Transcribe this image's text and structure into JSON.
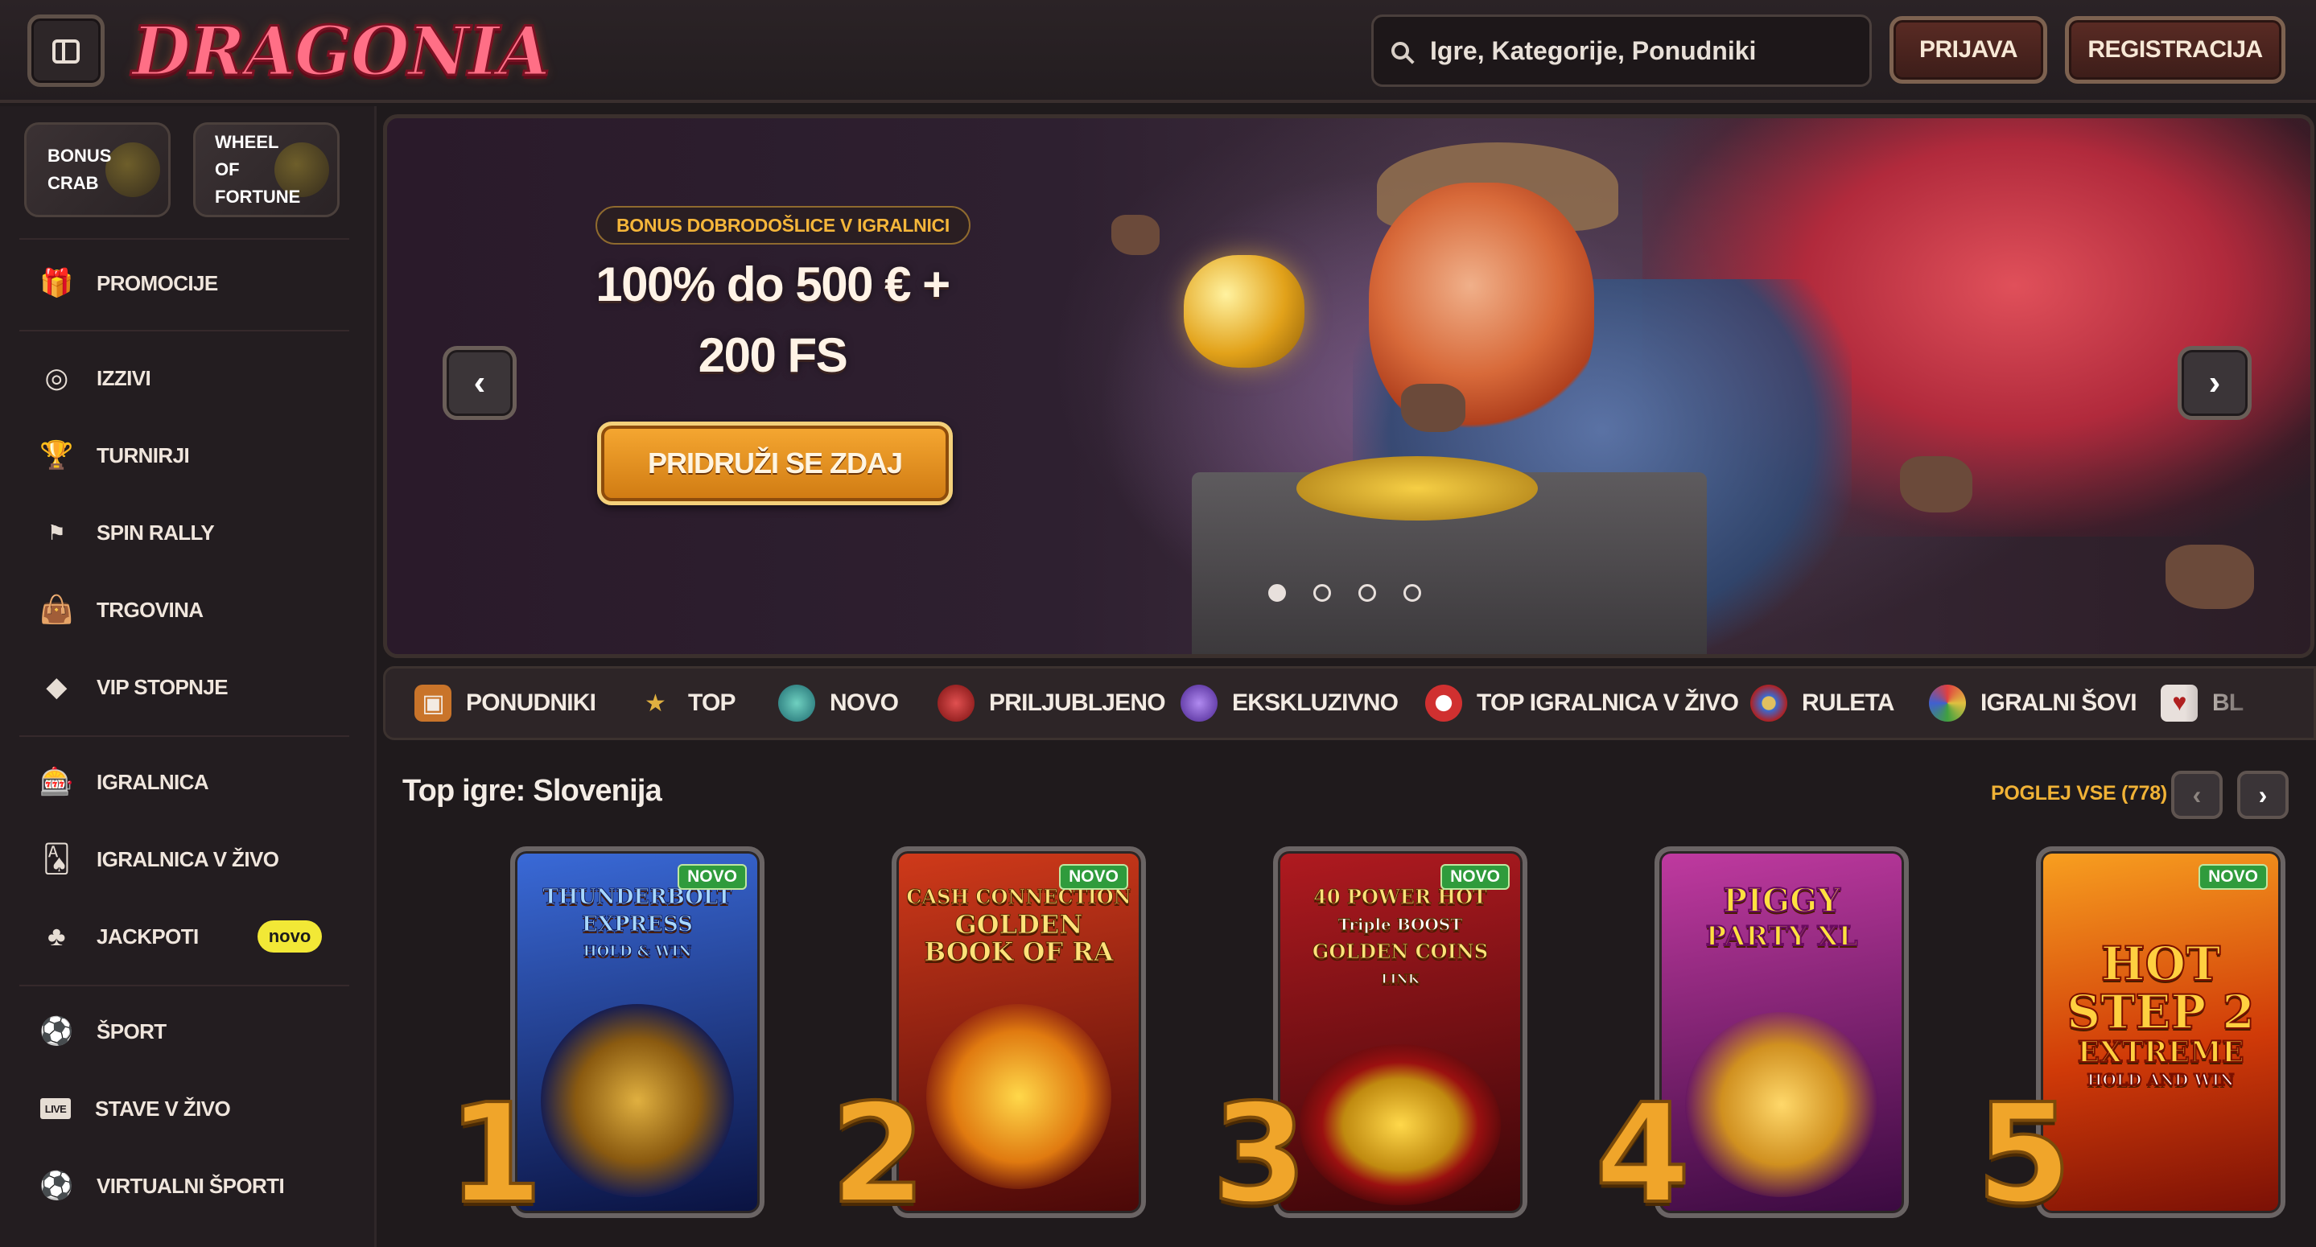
{
  "header": {
    "logo_text": "DRAGONIA",
    "search_placeholder": "Igre, Kategorije, Ponudniki",
    "login_label": "PRIJAVA",
    "register_label": "REGISTRACIJA"
  },
  "sidebar": {
    "features": [
      {
        "lines": [
          "BONUS",
          "CRAB"
        ],
        "icon": "crab-icon"
      },
      {
        "lines": [
          "WHEEL",
          "OF",
          "FORTUNE"
        ],
        "icon": "wheel-icon"
      }
    ],
    "items": [
      {
        "label": "PROMOCIJE",
        "icon": "gift-icon"
      },
      {
        "label": "IZZIVI",
        "icon": "target-icon"
      },
      {
        "label": "TURNIRJI",
        "icon": "trophy-icon"
      },
      {
        "label": "SPIN RALLY",
        "icon": "flag-icon"
      },
      {
        "label": "TRGOVINA",
        "icon": "shopping-bag-icon"
      },
      {
        "label": "VIP STOPNJE",
        "icon": "diamond-icon"
      },
      {
        "label": "IGRALNICA",
        "icon": "slot-machine-icon"
      },
      {
        "label": "IGRALNICA V ŽIVO",
        "icon": "playing-card-icon"
      },
      {
        "label": "JACKPOTI",
        "icon": "clover-icon",
        "badge": "novo"
      },
      {
        "label": "ŠPORT",
        "icon": "ball-icon"
      },
      {
        "label": "STAVE V ŽIVO",
        "icon": "live-icon",
        "icon_text": "LIVE"
      },
      {
        "label": "VIRTUALNI ŠPORTI",
        "icon": "virtual-ball-icon"
      }
    ]
  },
  "hero": {
    "tag": "BONUS DOBRODOŠLICE V IGRALNICI",
    "title_line1": "100% do 500 € +",
    "title_line2": "200 FS",
    "cta": "PRIDRUŽI SE ZDAJ",
    "slides_count": 4,
    "active_slide": 1
  },
  "categories": [
    {
      "label": "PONUDNIKI",
      "icon": "providers-icon",
      "color": "#c9742a"
    },
    {
      "label": "TOP",
      "icon": "star-icon",
      "color": "#e0b040"
    },
    {
      "label": "NOVO",
      "icon": "egg-icon",
      "color": "#3a9a9a"
    },
    {
      "label": "PRILJUBLJENO",
      "icon": "bomb-icon",
      "color": "#c03030"
    },
    {
      "label": "EKSKLUZIVNO",
      "icon": "gem-icon",
      "color": "#7a4ad0"
    },
    {
      "label": "TOP IGRALNICA V ŽIVO",
      "icon": "chip-icon",
      "color": "#d03030"
    },
    {
      "label": "RULETA",
      "icon": "roulette-icon",
      "color": "#3a6ad0"
    },
    {
      "label": "IGRALNI ŠOVI",
      "icon": "wheel-show-icon",
      "color": "#3a9a3a"
    },
    {
      "label": "BL",
      "icon": "cards-icon",
      "color": "#d0d0d0"
    }
  ],
  "top_games": {
    "title": "Top igre: Slovenija",
    "see_all": "POGLEJ VSE (778)",
    "prev": "‹",
    "next": "›",
    "games": [
      {
        "rank": "1",
        "name_lines": [
          "THUNDERBOLT",
          "EXPRESS",
          "HOLD & WIN"
        ],
        "badge": "NOVO",
        "bg1": "#1e3fa8",
        "bg2": "#0a1240"
      },
      {
        "rank": "2",
        "name_lines": [
          "CASH CONNECTION",
          "GOLDEN",
          "BOOK OF RA"
        ],
        "badge": "NOVO",
        "bg1": "#c0281a",
        "bg2": "#4a0808"
      },
      {
        "rank": "3",
        "name_lines": [
          "40 POWER HOT",
          "Triple BOOST",
          "GOLDEN COINS",
          "LINK"
        ],
        "badge": "NOVO",
        "bg1": "#a8141a",
        "bg2": "#3a0608"
      },
      {
        "rank": "4",
        "name_lines": [
          "PIGGY",
          "PARTY XL"
        ],
        "badge": "",
        "bg1": "#b0208a",
        "bg2": "#3a0a40"
      },
      {
        "rank": "5",
        "name_lines": [
          "HOT",
          "STEP 2",
          "EXTREME",
          "HOLD AND WIN"
        ],
        "badge": "NOVO",
        "bg1": "#f06a10",
        "bg2": "#8a1a06"
      }
    ]
  }
}
